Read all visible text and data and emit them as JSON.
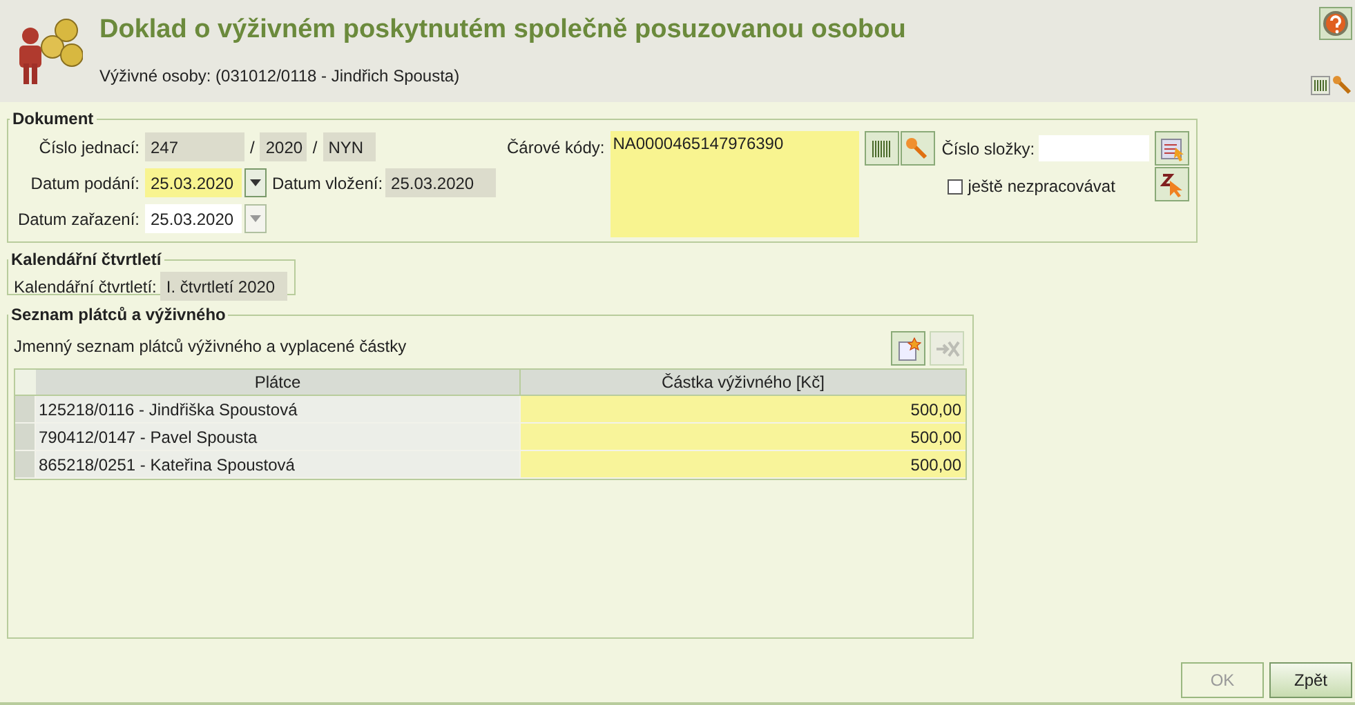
{
  "header": {
    "title": "Doklad o výživném poskytnutém společně posuzovanou osobou",
    "subtitle": "Výživné osoby: (031012/0118 - Jindřich Spousta)"
  },
  "dokument": {
    "legend": "Dokument",
    "cislo_jednaci": {
      "label": "Číslo jednací:",
      "parts": [
        {
          "value": "247",
          "kind": "readonly"
        },
        {
          "sep": "/",
          "value": "2020",
          "kind": "readonly"
        },
        {
          "sep": "/",
          "value": "NYN",
          "kind": "readonly"
        }
      ]
    },
    "datum_podani": {
      "label": "Datum podání:",
      "value": "25.03.2020",
      "kind": "required",
      "dropdown_disabled": false
    },
    "datum_vlozeni": {
      "label": "Datum vložení:",
      "value": "25.03.2020",
      "kind": "readonly"
    },
    "datum_zarazeni": {
      "label": "Datum zařazení:",
      "value": "25.03.2020",
      "kind": "plain",
      "dropdown_disabled": true
    },
    "carove_kody": {
      "label": "Čárové kódy:",
      "value": "NA0000465147976390",
      "kind": "required"
    },
    "cislo_slozky": {
      "label": "Číslo složky:",
      "kind": "plain"
    },
    "nezpracovavat": {
      "label": "ještě nezpracovávat",
      "checked": false
    }
  },
  "kalendar": {
    "legend": "Kalendářní čtvrtletí",
    "label": "Kalendářní čtvrtletí:",
    "value": "I. čtvrtletí 2020",
    "kind": "readonly"
  },
  "seznam": {
    "legend": "Seznam plátců a výživného",
    "caption": "Jmenný seznam plátců výživného a vyplacené částky",
    "add_disabled": false,
    "remove_disabled": true,
    "table": {
      "columns": [
        "Plátce",
        "Částka výživného [Kč]"
      ],
      "rows": [
        {
          "platce": "125218/0116 - Jindřiška Spoustová",
          "castka": "500,00"
        },
        {
          "platce": "790412/0147 - Pavel Spousta",
          "castka": "500,00"
        },
        {
          "platce": "865218/0251 - Kateřina Spoustová",
          "castka": "500,00"
        }
      ]
    }
  },
  "buttons": [
    {
      "label": "OK",
      "disabled": true
    },
    {
      "label": "Zpět",
      "disabled": false
    }
  ]
}
